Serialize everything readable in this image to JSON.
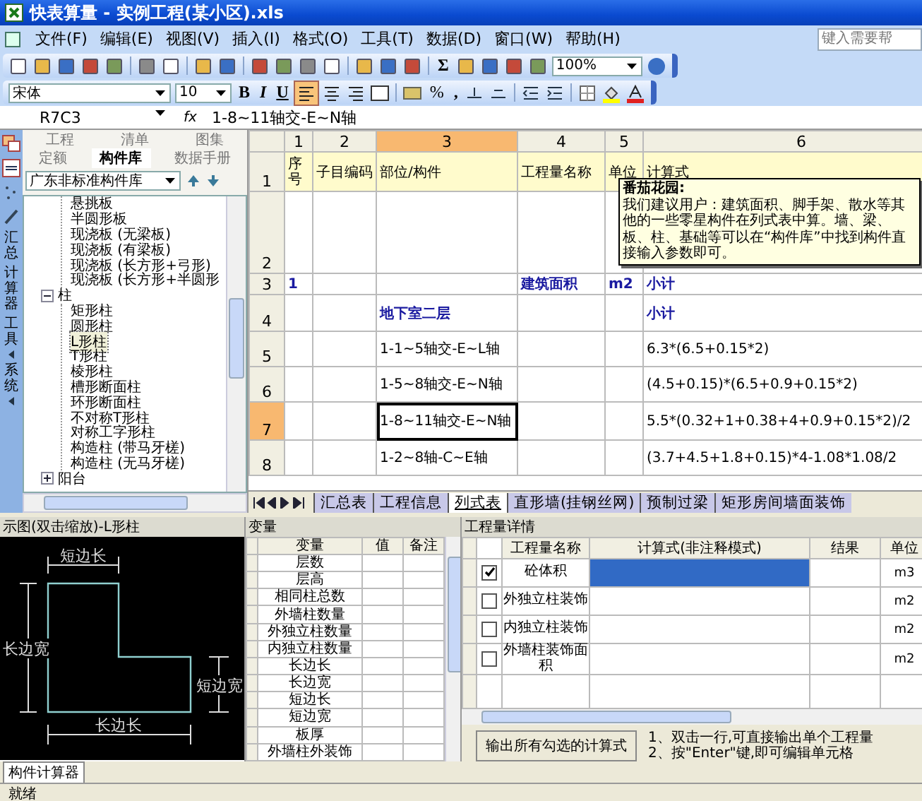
{
  "window": {
    "title": "快表算量 - 实例工程(某小区).xls"
  },
  "menu": [
    "文件(F)",
    "编辑(E)",
    "视图(V)",
    "插入(I)",
    "格式(O)",
    "工具(T)",
    "数据(D)",
    "窗口(W)",
    "帮助(H)"
  ],
  "help_search": {
    "placeholder": "键入需要帮"
  },
  "toolbar": {
    "sum": "Σ",
    "zoom": "100%"
  },
  "format_bar": {
    "font": "宋体",
    "size": "10",
    "bold": "B",
    "italic": "I",
    "underline": "U",
    "align_left_on": true,
    "percent": "%",
    "comma": ","
  },
  "formula_bar": {
    "cell_ref": "R7C3",
    "fx": "fx",
    "value": "1-8~11轴交-E~N轴"
  },
  "side_strip": [
    {
      "label": "汇总",
      "has_menu": false
    },
    {
      "label": "计算器",
      "has_menu": false
    },
    {
      "label": "工具",
      "has_menu": true
    },
    {
      "label": "系统",
      "has_menu": true
    }
  ],
  "library": {
    "tabs_top": [
      {
        "label": "工程",
        "selected": false
      },
      {
        "label": "清单",
        "selected": false
      },
      {
        "label": "图集",
        "selected": false
      }
    ],
    "tabs_bottom": [
      {
        "label": "定额",
        "selected": false
      },
      {
        "label": "构件库",
        "selected": true
      },
      {
        "label": "数据手册",
        "selected": false
      }
    ],
    "select": "广东非标准构件库",
    "tree_continued": [
      {
        "label": "悬挑板",
        "selected": false
      },
      {
        "label": "半圆形板",
        "selected": false
      },
      {
        "label": "现浇板 (无梁板)",
        "selected": false
      },
      {
        "label": "现浇板 (有梁板)",
        "selected": false
      },
      {
        "label": "现浇板 (长方形+弓形)",
        "selected": false
      },
      {
        "label": "现浇板 (长方形+半圆形",
        "selected": false
      }
    ],
    "tree": [
      {
        "label": "柱",
        "expanded": true,
        "children": [
          {
            "label": "矩形柱",
            "selected": false
          },
          {
            "label": "圆形柱",
            "selected": false
          },
          {
            "label": "L形柱",
            "selected": true
          },
          {
            "label": "T形柱",
            "selected": false
          },
          {
            "label": "棱形柱",
            "selected": false
          },
          {
            "label": "槽形断面柱",
            "selected": false
          },
          {
            "label": "环形断面柱",
            "selected": false
          },
          {
            "label": "不对称T形柱",
            "selected": false
          },
          {
            "label": "对称工字形柱",
            "selected": false
          },
          {
            "label": "构造柱 (带马牙槎)",
            "selected": false
          },
          {
            "label": "构造柱 (无马牙槎)",
            "selected": false
          }
        ]
      },
      {
        "label": "阳台",
        "expanded": false
      }
    ]
  },
  "sheet": {
    "column_headers": [
      {
        "label": "1",
        "selected": false
      },
      {
        "label": "2",
        "selected": false
      },
      {
        "label": "3",
        "selected": true
      },
      {
        "label": "4",
        "selected": false
      },
      {
        "label": "5",
        "selected": false
      },
      {
        "label": "6",
        "selected": false
      }
    ],
    "rows": [
      {
        "number": "1",
        "selected": false,
        "kind": "header",
        "seq": "序号",
        "code": "子目编码",
        "part": "部位/构件",
        "quantity_name": "工程量名称",
        "unit": "单位",
        "formula": "计算式"
      },
      {
        "number": "2",
        "selected": false,
        "kind": "blank"
      },
      {
        "number": "3",
        "selected": false,
        "kind": "total",
        "seq": "1",
        "quantity_name": "建筑面积",
        "unit": "m2",
        "formula": "小计"
      },
      {
        "number": "4",
        "selected": false,
        "kind": "total",
        "part": "地下室二层",
        "formula": "小计"
      },
      {
        "number": "5",
        "selected": false,
        "kind": "item",
        "part": "1-1~5轴交-E~L轴",
        "formula": "6.3*(6.5+0.15*2)"
      },
      {
        "number": "6",
        "selected": false,
        "kind": "item",
        "part": "1-5~8轴交-E~N轴",
        "formula": "(4.5+0.15)*(6.5+0.9+0.15*2)"
      },
      {
        "number": "7",
        "selected": true,
        "kind": "item",
        "part": "1-8~11轴交-E~N轴",
        "formula": "5.5*(0.32+1+0.38+4+0.9+0.15*2)/2"
      },
      {
        "number": "8",
        "selected": false,
        "kind": "item",
        "part": "1-2~8轴-C~E轴",
        "formula": "(3.7+4.5+1.8+0.15)*4-1.08*1.08/2"
      }
    ],
    "comment": {
      "author": "番茄花园:",
      "text": "我们建议用户：建筑面积、脚手架、散水等其他的一些零星构件在列式表中算。墙、梁、板、柱、基础等可以在“构件库”中找到构件直接输入参数即可。"
    }
  },
  "sheet_tabs": [
    {
      "label": "汇总表",
      "selected": false
    },
    {
      "label": "工程信息",
      "selected": false
    },
    {
      "label": "列式表",
      "selected": true
    },
    {
      "label": "直形墙(挂钢丝网)",
      "selected": false
    },
    {
      "label": "预制过梁",
      "selected": false
    },
    {
      "label": "矩形房间墙面装饰",
      "selected": false
    }
  ],
  "diagram": {
    "title": "示图(双击缩放)-L形柱",
    "top": "短边长",
    "left": "长边宽",
    "right": "短边宽",
    "bottom": "长边长"
  },
  "variables": {
    "title": "变量",
    "columns": [
      "变量",
      "值",
      "备注"
    ],
    "rows": [
      "层数",
      "层高",
      "相同柱总数",
      "外墙柱数量",
      "外独立柱数量",
      "内独立柱数量",
      "长边长",
      "长边宽",
      "短边长",
      "短边宽",
      "板厚",
      "外墙柱外装饰"
    ]
  },
  "details": {
    "title": "工程量详情",
    "columns": [
      "工程量名称",
      "计算式(非注释模式)",
      "结果",
      "单位"
    ],
    "rows": [
      {
        "checked": true,
        "name": "砼体积",
        "unit": "m3",
        "selected": true
      },
      {
        "checked": false,
        "name": "外独立柱装饰",
        "unit": "m2",
        "selected": false
      },
      {
        "checked": false,
        "name": "内独立柱装饰",
        "unit": "m2",
        "selected": false
      },
      {
        "checked": false,
        "name": "外墙柱装饰面积",
        "unit": "m2",
        "selected": false
      }
    ],
    "button": "输出所有勾选的计算式",
    "notes": [
      "1、双击一行,可直接输出单个工程量",
      "2、按\"Enter\"键,即可编辑单元格"
    ]
  },
  "bottom_tab": "构件计算器",
  "status": "就绪"
}
